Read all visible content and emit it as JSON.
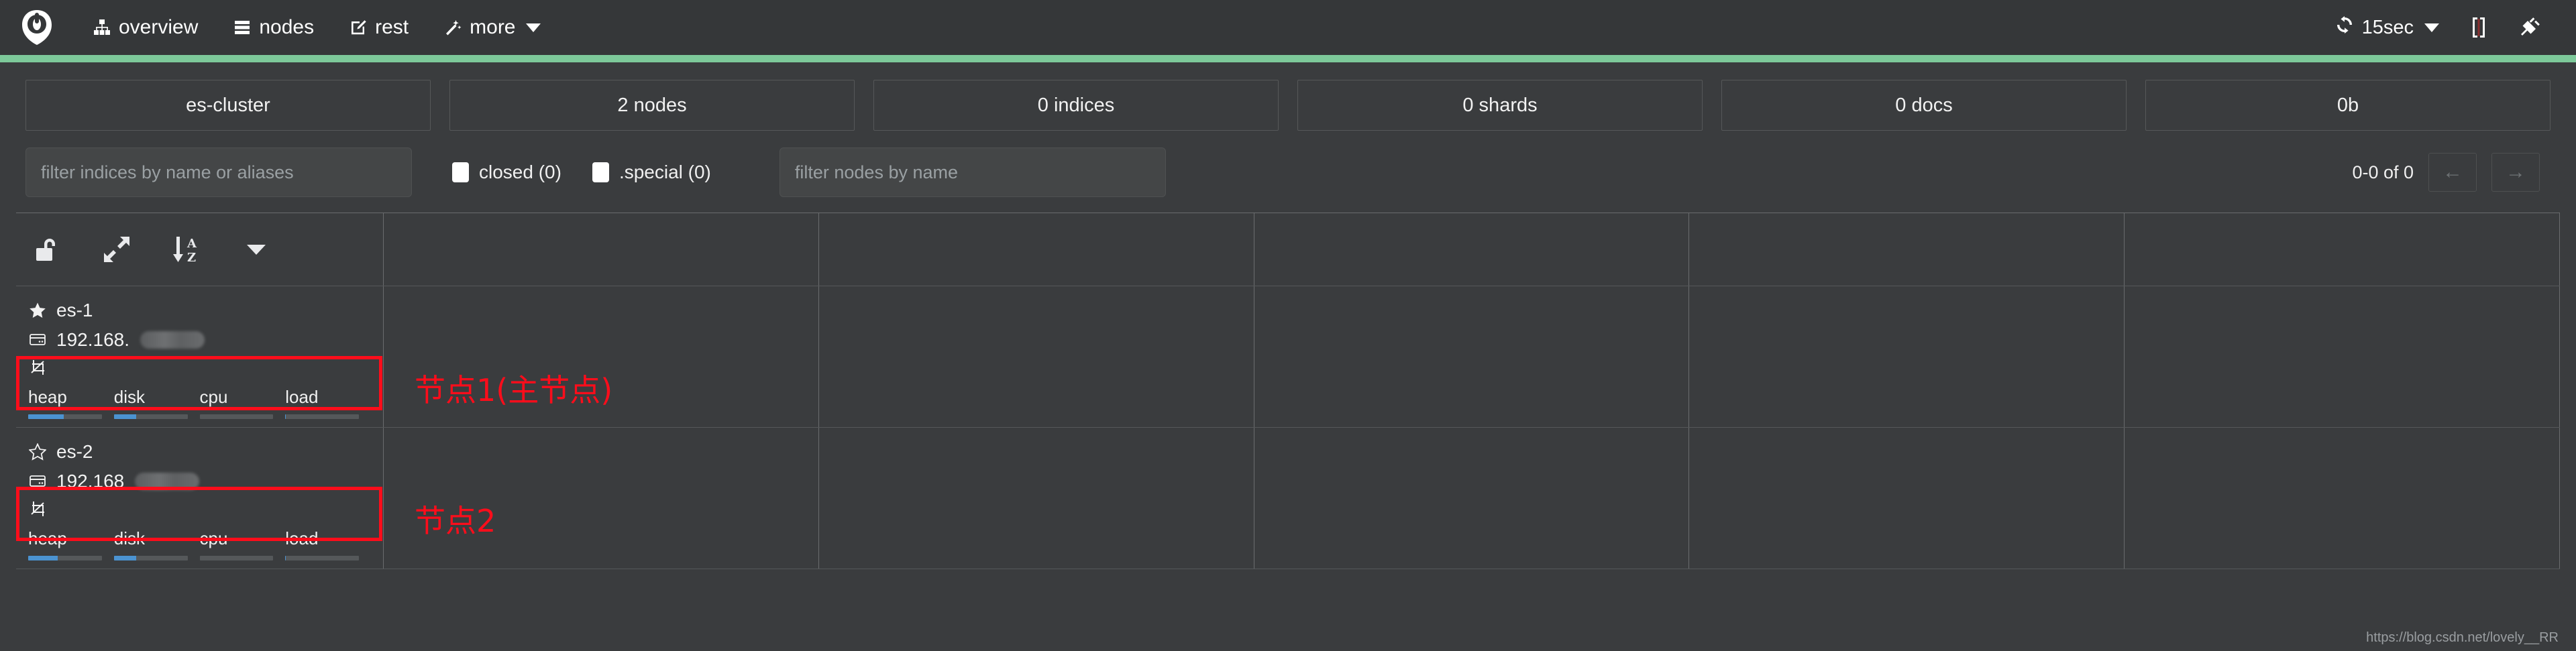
{
  "navbar": {
    "brand_icon": "cerebro-logo-icon",
    "items": [
      {
        "icon": "sitemap-icon",
        "label": "overview"
      },
      {
        "icon": "server-stack-icon",
        "label": "nodes"
      },
      {
        "icon": "edit-square-icon",
        "label": "rest"
      },
      {
        "icon": "magic-wand-icon",
        "label": "more",
        "has_caret": true
      }
    ],
    "refresh": {
      "icon": "refresh-icon",
      "label": "15sec",
      "has_caret": true
    },
    "right_icons": [
      {
        "icon": "brackets-icon",
        "label": "[]"
      },
      {
        "icon": "plug-disconnect-icon",
        "label": ""
      }
    ]
  },
  "health": {
    "status_color": "#7dc99a"
  },
  "cluster_stats": [
    {
      "name": "cluster-name",
      "label": "es-cluster"
    },
    {
      "name": "nodes-count",
      "label": "2 nodes"
    },
    {
      "name": "indices-count",
      "label": "0 indices"
    },
    {
      "name": "shards-count",
      "label": "0 shards"
    },
    {
      "name": "docs-count",
      "label": "0 docs"
    },
    {
      "name": "store-size",
      "label": "0b"
    }
  ],
  "filters": {
    "indices_placeholder": "filter indices by name or aliases",
    "indices_value": "",
    "closed_label": "closed (0)",
    "special_label": ".special (0)",
    "nodes_placeholder": "filter nodes by name",
    "nodes_value": "",
    "pager_label": "0-0 of 0",
    "prev_label": "←",
    "next_label": "→"
  },
  "table": {
    "tools": [
      {
        "name": "lock-toggle",
        "icon": "unlock-icon"
      },
      {
        "name": "expand-toggle",
        "icon": "expand-arrows-icon"
      },
      {
        "name": "sort-az",
        "icon": "sort-alpha-down-icon"
      },
      {
        "name": "sort-options",
        "icon": "caret-down-icon"
      }
    ],
    "metric_labels": [
      "heap",
      "disk",
      "cpu",
      "load"
    ],
    "nodes": [
      {
        "name": "es-1",
        "master": true,
        "star_icon": "star-filled-icon",
        "host_icon": "server-icon",
        "ip_prefix": "192.168.",
        "role_icon": "master-eligible-icon",
        "metrics": [
          {
            "label": "heap",
            "percent": 48
          },
          {
            "label": "disk",
            "percent": 30
          },
          {
            "label": "cpu",
            "percent": 0
          },
          {
            "label": "load",
            "percent": 1
          }
        ]
      },
      {
        "name": "es-2",
        "master": false,
        "star_icon": "star-outline-icon",
        "host_icon": "server-icon",
        "ip_prefix": "192.168",
        "role_icon": "master-eligible-icon",
        "metrics": [
          {
            "label": "heap",
            "percent": 40
          },
          {
            "label": "disk",
            "percent": 30
          },
          {
            "label": "cpu",
            "percent": 0
          },
          {
            "label": "load",
            "percent": 1
          }
        ]
      }
    ]
  },
  "annotations": [
    {
      "name": "annotation-node-1",
      "text": "节点1(主节点)"
    },
    {
      "name": "annotation-node-2",
      "text": "节点2"
    }
  ],
  "watermark": {
    "text": "https://blog.csdn.net/lovely__RR"
  },
  "colors": {
    "accent_green": "#7dc99a",
    "metric_blue": "#4b93d1",
    "annotation_red": "#fc0d1b",
    "navbar_bg": "#353739",
    "page_bg": "#3a3c3e"
  }
}
